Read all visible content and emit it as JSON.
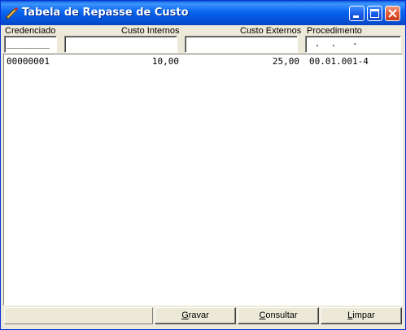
{
  "window": {
    "title": "Tabela de Repasse de Custo",
    "icon": "app-pen-icon",
    "controls": [
      "minimize-icon",
      "maximize-icon",
      "close-icon"
    ]
  },
  "columns": {
    "credenciado": "Credenciado",
    "custo_internos": "Custo Internos",
    "custo_externos": "Custo Externos",
    "procedimento": "Procedimento"
  },
  "filters": {
    "credenciado_mask": "________",
    "custo_internos_value": "",
    "custo_externos_value": "",
    "procedimento_mask": " .  .   -"
  },
  "rows": [
    {
      "credenciado": "00000001",
      "custo_internos": "10,00",
      "custo_externos": "25,00",
      "procedimento": "00.01.001-4"
    }
  ],
  "buttons": {
    "gravar": {
      "first": "G",
      "rest": "ravar"
    },
    "consultar": {
      "first": "C",
      "rest": "onsultar"
    },
    "limpar": {
      "first": "L",
      "rest": "impar"
    }
  },
  "colors": {
    "titlebar": "#0552d9",
    "face": "#ece9d8",
    "close": "#e0532c"
  }
}
